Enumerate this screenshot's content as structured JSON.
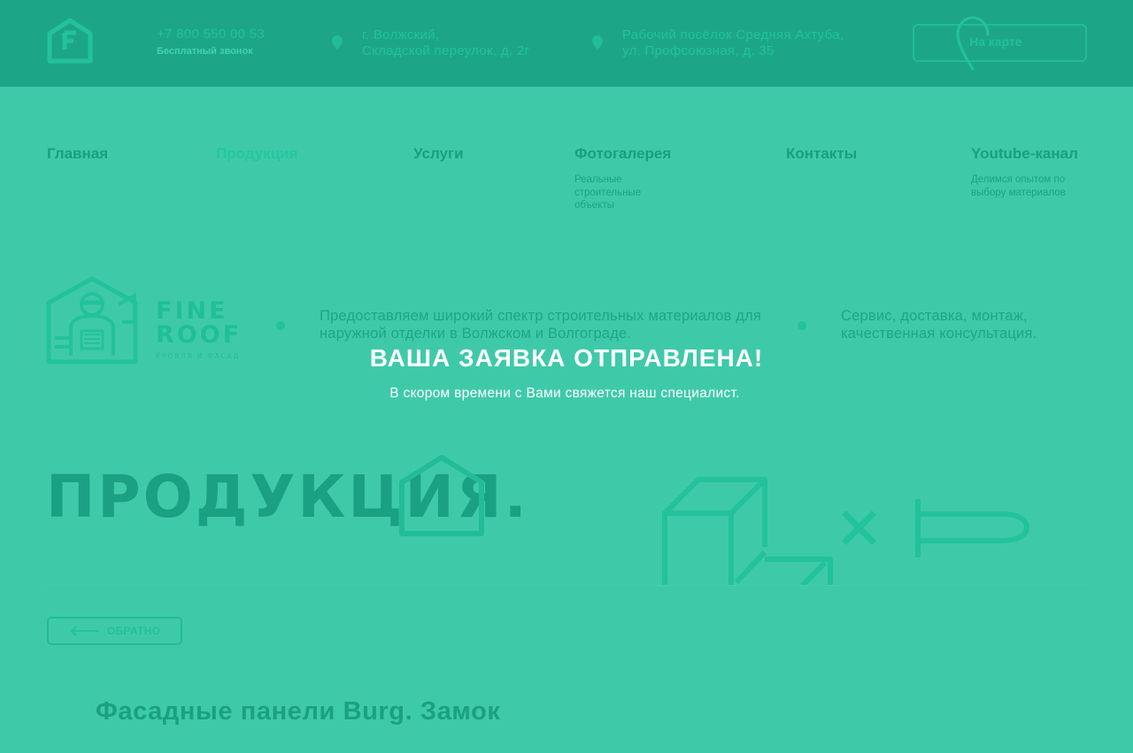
{
  "header": {
    "phone": "+7 800 550 00 53",
    "phone_note": "Бесплатный звонок",
    "address1": [
      "г. Волжский,",
      "Складской переулок, д. 2г"
    ],
    "address2": [
      "Рабочий посёлок Средняя Ахтуба,",
      "ул. Профсоюзная, д. 35"
    ],
    "map_button_label": "На карте"
  },
  "nav": {
    "items": [
      {
        "label": "Главная",
        "sub": ""
      },
      {
        "label": "Продукция",
        "sub": "",
        "active": true
      },
      {
        "label": "Услуги",
        "sub": ""
      },
      {
        "label": "Фотогалерея",
        "sub": "Реальные строительные объекты"
      },
      {
        "label": "Контакты",
        "sub": ""
      },
      {
        "label": "Youtube-канал",
        "sub": "Делимся опытом по выбору материалов"
      }
    ]
  },
  "brand": {
    "line1": "FINE",
    "line2": "ROOF",
    "tagline": "КРОВЛЯ И ФАСАД"
  },
  "intro": {
    "text1": "Предоставляем широкий спектр строительных материалов для наружной отделки в Волжском и Волгограде.",
    "text2": "Сервис, доставка, монтаж, качественная консультация."
  },
  "modal": {
    "title": "ВАША ЗАЯВКА ОТПРАВЛЕНА!",
    "text": "В скором времени с Вами свяжется наш специалист."
  },
  "page": {
    "title": "ПРОДУКЦИЯ.",
    "back_label": "ОБРАТНО",
    "product_title": "Фасадные панели Burg. Замок"
  },
  "colors": {
    "background": "#3ecaa8",
    "header": "#1ca687",
    "accent": "#22c29c",
    "modal_text": "#ffffff"
  },
  "icons": [
    "logo-house-icon",
    "location-pin-icon",
    "map-pin-icon",
    "brand-worker-illustration",
    "house-outline-icon",
    "box-illustration",
    "cross-icon",
    "nail-illustration",
    "arrow-left-icon"
  ]
}
